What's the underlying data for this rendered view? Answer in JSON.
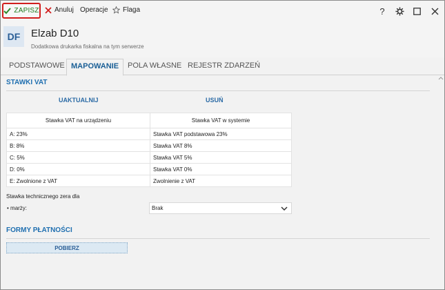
{
  "toolbar": {
    "save_label": "ZAPISZ",
    "cancel_label": "Anuluj",
    "operations_label": "Operacje",
    "flag_label": "Flaga"
  },
  "header": {
    "avatar_initials": "DF",
    "title": "Elzab D10",
    "subtitle": "Dodatkowa drukarka fiskalna na tym serwerze"
  },
  "tabs": [
    {
      "label": "PODSTAWOWE",
      "active": false
    },
    {
      "label": "MAPOWANIE",
      "active": true
    },
    {
      "label": "POLA WŁASNE",
      "active": false
    },
    {
      "label": "REJESTR ZDARZEŃ",
      "active": false
    }
  ],
  "vat_section": {
    "title": "STAWKI VAT",
    "update_label": "UAKTUALNIJ",
    "delete_label": "USUŃ",
    "columns": [
      "Stawka VAT na urządzeniu",
      "Stawka VAT w systemie"
    ],
    "rows": [
      [
        "A: 23%",
        "Stawka VAT podstawowa 23%"
      ],
      [
        "B: 8%",
        "Stawka VAT 8%"
      ],
      [
        "C: 5%",
        "Stawka VAT 5%"
      ],
      [
        "D: 0%",
        "Stawka VAT 0%"
      ],
      [
        "E: Zwolnione z VAT",
        "Zwolnienie z VAT"
      ]
    ],
    "technical_zero_label": "Stawka technicznego zera dla",
    "margin_label": "• marży:",
    "margin_value": "Brak"
  },
  "payments_section": {
    "title": "FORMY PŁATNOŚCI",
    "fetch_label": "POBIERZ"
  },
  "colors": {
    "accent": "#1f6fb0",
    "save_border": "#d11e1e",
    "save_text": "#1f7a1f"
  }
}
